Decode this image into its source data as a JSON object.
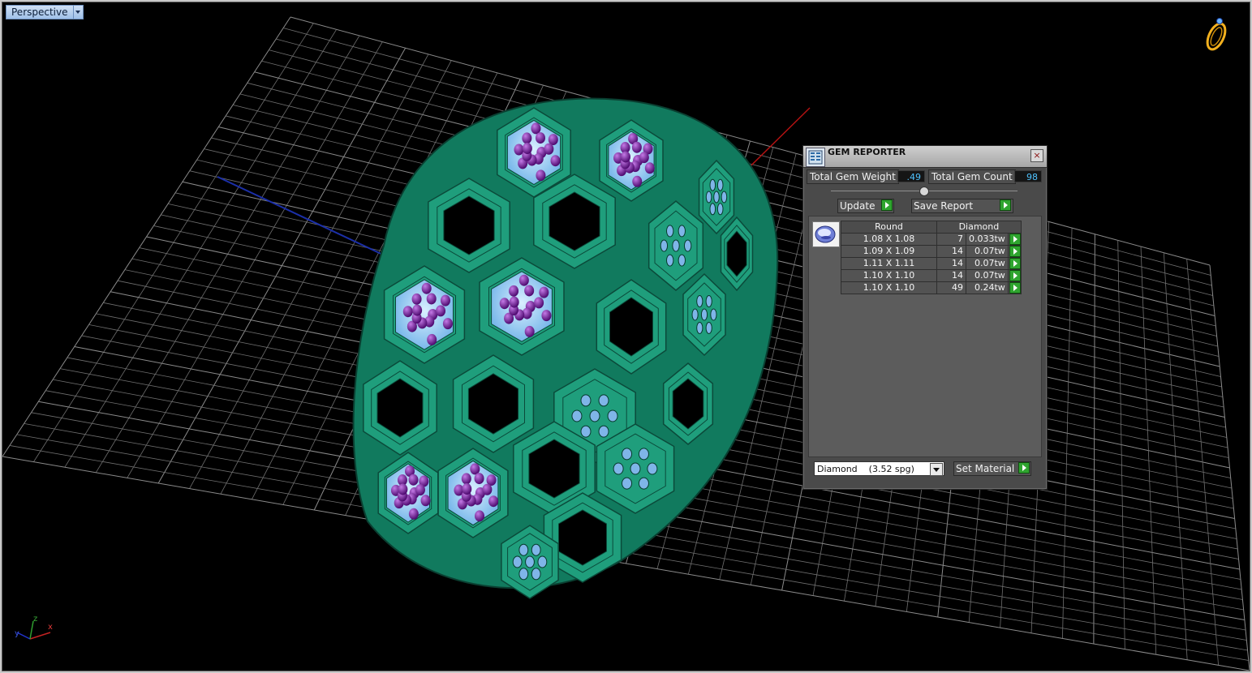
{
  "viewport": {
    "name": "Perspective",
    "axis_labels": {
      "x": "x",
      "y": "y",
      "z": "z"
    }
  },
  "gem_reporter": {
    "title": "GEM REPORTER",
    "close_label": "×",
    "total_weight_label": "Total Gem Weight",
    "total_weight_value": ".49",
    "total_count_label": "Total Gem Count",
    "total_count_value": "98",
    "update_label": "Update",
    "save_report_label": "Save Report",
    "columns": {
      "shape": "Round",
      "material": "Diamond"
    },
    "rows": [
      {
        "size": "1.08 X 1.08",
        "count": "7",
        "weight": "0.033tw"
      },
      {
        "size": "1.09 X 1.09",
        "count": "14",
        "weight": "0.07tw"
      },
      {
        "size": "1.11 X 1.11",
        "count": "14",
        "weight": "0.07tw"
      },
      {
        "size": "1.10 X 1.10",
        "count": "14",
        "weight": "0.07tw"
      },
      {
        "size": "1.10 X 1.10",
        "count": "49",
        "weight": "0.24tw"
      }
    ],
    "material_select": "Diamond    (3.52 spg)",
    "set_material_label": "Set Material"
  },
  "colors": {
    "ring_metal": "#1f9e7c",
    "gem": "#8fc8f2",
    "prong": "#7a1aa0",
    "grid": "#6f6f6f",
    "x_axis": "#b31212",
    "y_axis": "#1b2fa8",
    "accent_go": "#2fa52f"
  }
}
